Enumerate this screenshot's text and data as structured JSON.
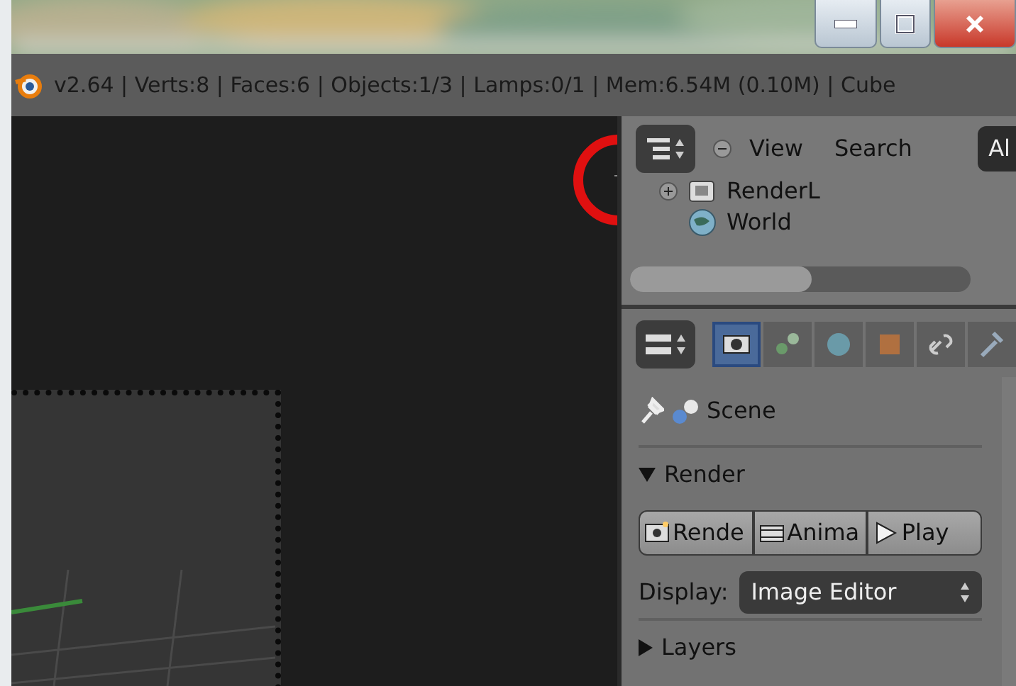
{
  "info_bar": {
    "text": "v2.64 | Verts:8 | Faces:6 | Objects:1/3 | Lamps:0/1 | Mem:6.54M (0.10M) | Cube"
  },
  "outliner": {
    "menus": [
      "View",
      "Search"
    ],
    "cut_button": "Al",
    "items": [
      {
        "kind": "renderlayer",
        "label": "RenderL"
      },
      {
        "kind": "world",
        "label": "World"
      }
    ]
  },
  "properties": {
    "tabs": [
      {
        "kind": "render",
        "selected": true
      },
      {
        "kind": "scene",
        "selected": false
      },
      {
        "kind": "world",
        "selected": false
      },
      {
        "kind": "object",
        "selected": false
      },
      {
        "kind": "constraint",
        "selected": false
      },
      {
        "kind": "modifier",
        "selected": false
      }
    ],
    "context": "Scene",
    "panels": [
      {
        "title": "Render",
        "expanded": true,
        "buttons": [
          {
            "kind": "render",
            "label": "Rende"
          },
          {
            "kind": "animation",
            "label": "Anima"
          },
          {
            "kind": "play",
            "label": "Play"
          }
        ],
        "display": {
          "label": "Display:",
          "value": "Image Editor"
        }
      },
      {
        "title": "Layers",
        "expanded": false
      }
    ]
  }
}
